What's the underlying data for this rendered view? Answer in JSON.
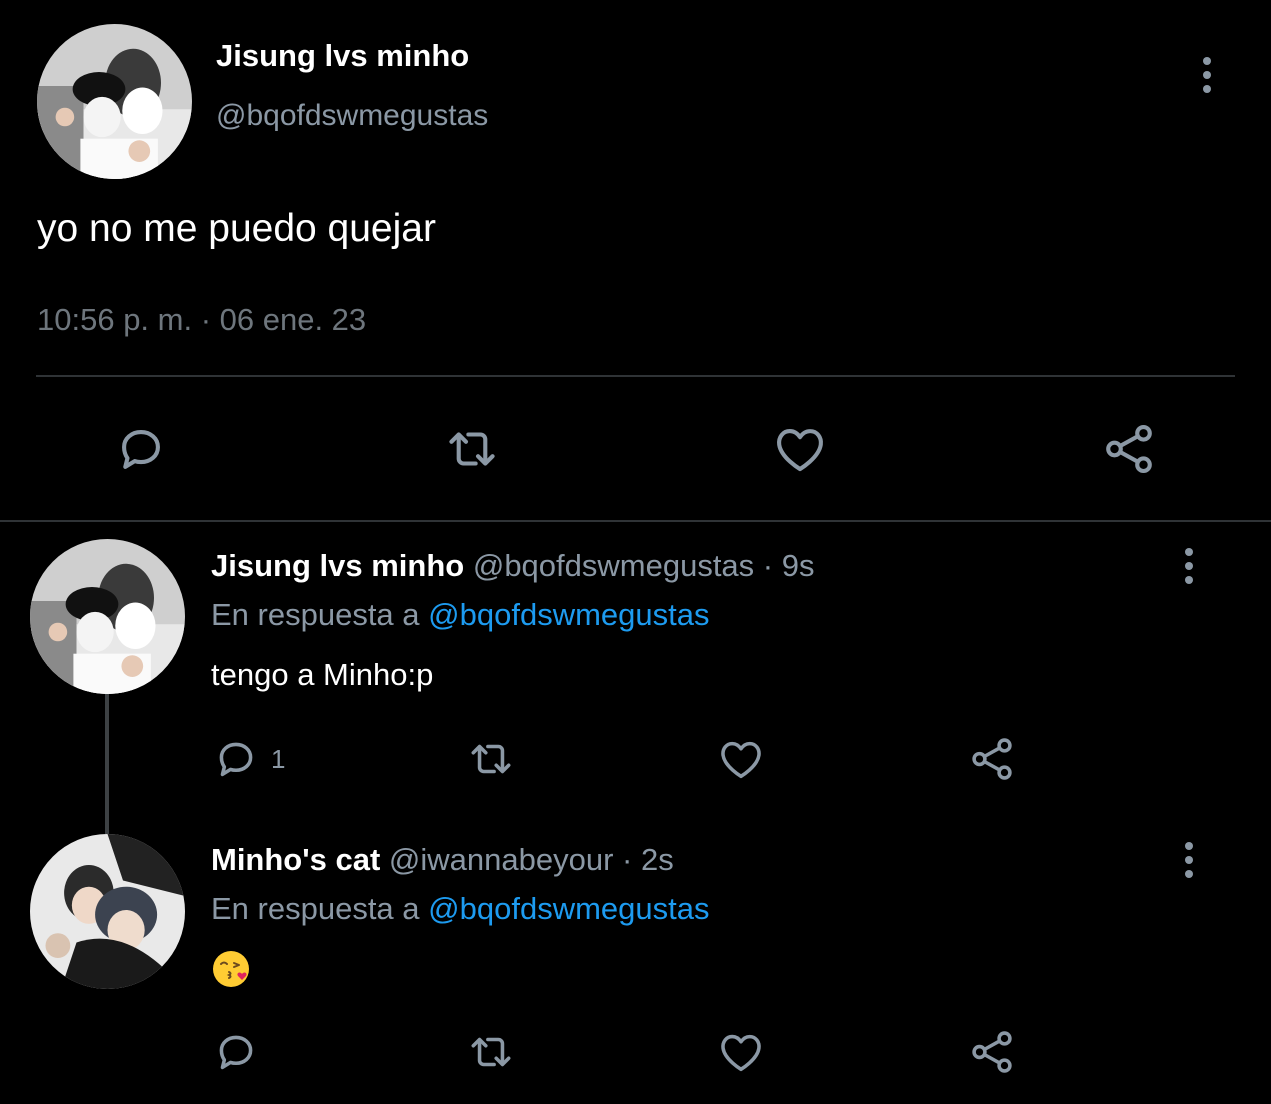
{
  "colors": {
    "background": "#000000",
    "primary_text": "#ffffff",
    "secondary_text": "#8b98a5",
    "link": "#1d9bf0",
    "divider": "#2f3336"
  },
  "main_tweet": {
    "author_name": "Jisung lvs minho",
    "handle": "@bqofdswmegustas",
    "text": "yo no me puedo quejar",
    "timestamp": "10:56 p. m. · 06 ene. 23",
    "actions": [
      "reply-icon",
      "retweet-icon",
      "like-icon",
      "share-icon"
    ]
  },
  "replies": [
    {
      "author_name": "Jisung lvs minho",
      "meta": "@bqofdswmegustas · 9s",
      "reply_prefix": "En respuesta a",
      "reply_to": "@bqofdswmegustas",
      "text": "tengo a Minho:p",
      "reply_count": "1"
    },
    {
      "author_name": "Minho's cat",
      "meta": "@iwannabeyour · 2s",
      "reply_prefix": "En respuesta a",
      "reply_to": "@bqofdswmegustas",
      "text": "😘",
      "emoji_name": "face-blowing-a-kiss"
    }
  ]
}
